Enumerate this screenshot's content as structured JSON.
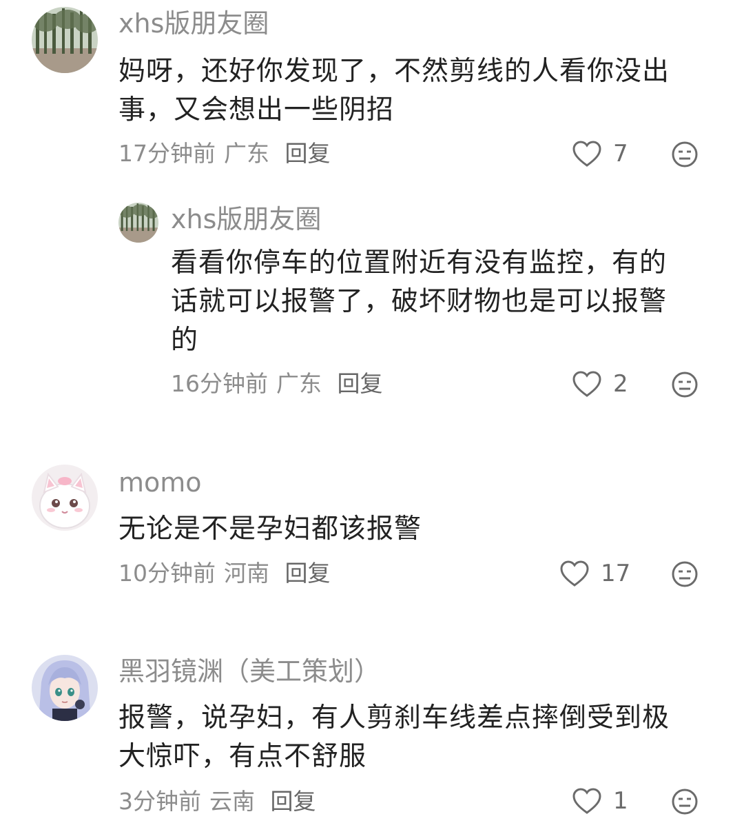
{
  "comments": [
    {
      "author": "xhs版朋友圈",
      "text_lines": [
        "妈呀，还好你发现了，不然剪线的人看你没出",
        "事，又会想出一些阴招"
      ],
      "time": "17分钟前",
      "location": "广东",
      "reply_label": "回复",
      "likes": "7",
      "avatar_icon": "forest-avatar",
      "reply": {
        "author": "xhs版朋友圈",
        "text_lines": [
          "看看你停车的位置附近有没有监控，有的",
          "话就可以报警了，破坏财物也是可以报警",
          "的"
        ],
        "time": "16分钟前",
        "location": "广东",
        "reply_label": "回复",
        "likes": "2",
        "avatar_icon": "forest-avatar"
      }
    },
    {
      "author": "momo",
      "text_lines": [
        "无论是不是孕妇都该报警"
      ],
      "time": "10分钟前",
      "location": "河南",
      "reply_label": "回复",
      "likes": "17",
      "avatar_icon": "white-cat-avatar"
    },
    {
      "author": "黑羽镜渊（美工策划）",
      "text_lines": [
        "报警，说孕妇，有人剪刹车线差点摔倒受到极",
        "大惊吓，有点不舒服"
      ],
      "time": "3分钟前",
      "location": "云南",
      "reply_label": "回复",
      "likes": "1",
      "avatar_icon": "anime-character-avatar"
    }
  ],
  "icons": {
    "like": "heart-outline-icon",
    "dislike": "meh-face-icon"
  },
  "colors": {
    "text": "#222222",
    "meta": "#8c8c8c",
    "icon": "#6b6b6b"
  }
}
